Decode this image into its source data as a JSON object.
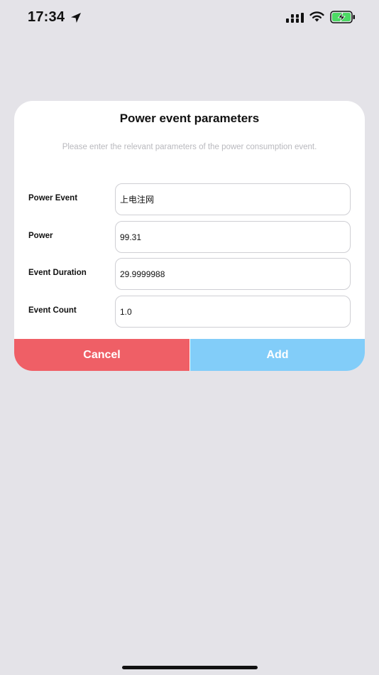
{
  "status_bar": {
    "time": "17:34"
  },
  "dialog": {
    "title": "Power event parameters",
    "subtitle": "Please enter the relevant parameters of the power consumption event.",
    "fields": [
      {
        "label": "Power Event",
        "value": "上电注网"
      },
      {
        "label": "Power",
        "value": "99.31"
      },
      {
        "label": "Event Duration",
        "value": "29.9999988"
      },
      {
        "label": "Event Count",
        "value": "1.0"
      }
    ],
    "cancel_label": "Cancel",
    "add_label": "Add"
  },
  "colors": {
    "background": "#e4e3e8",
    "cancel": "#ef5f66",
    "add": "#82cdf9",
    "battery_fill": "#4cd964"
  }
}
